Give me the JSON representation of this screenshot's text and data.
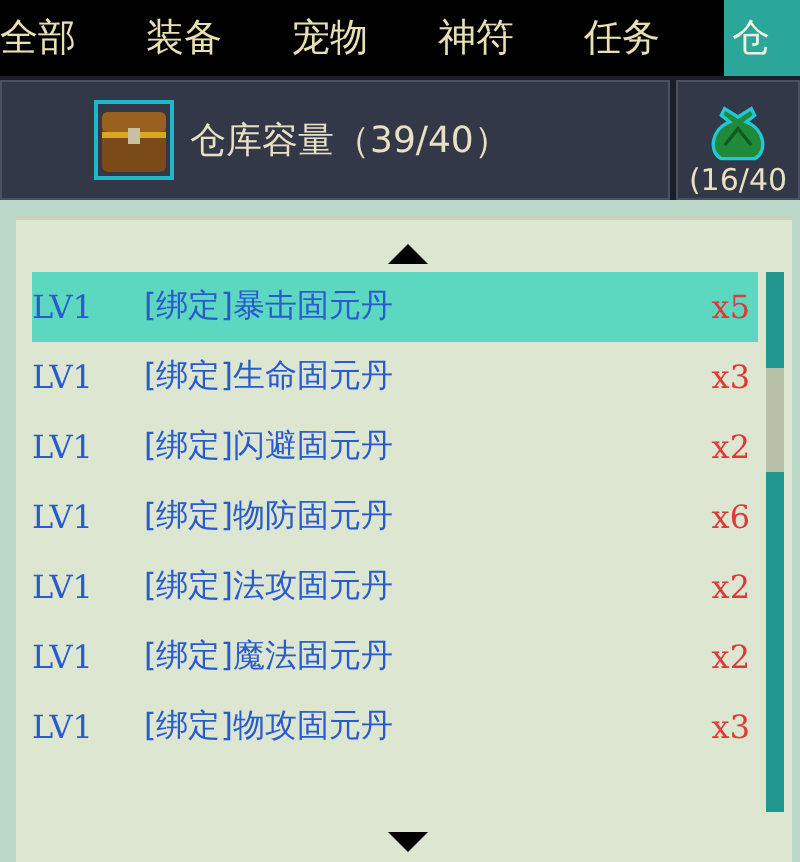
{
  "tabs": [
    {
      "label": "全部",
      "selected": false
    },
    {
      "label": "装备",
      "selected": false
    },
    {
      "label": "宠物",
      "selected": false
    },
    {
      "label": "神符",
      "selected": false
    },
    {
      "label": "任务",
      "selected": false
    },
    {
      "label": "仓",
      "selected": true
    }
  ],
  "capacity": {
    "label": "仓库容量（39/40）"
  },
  "bag": {
    "count": "(16/40"
  },
  "items": [
    {
      "level": "LV1",
      "name": "[绑定]暴击固元丹",
      "count": "x5",
      "selected": true
    },
    {
      "level": "LV1",
      "name": "[绑定]生命固元丹",
      "count": "x3",
      "selected": false
    },
    {
      "level": "LV1",
      "name": "[绑定]闪避固元丹",
      "count": "x2",
      "selected": false
    },
    {
      "level": "LV1",
      "name": "[绑定]物防固元丹",
      "count": "x6",
      "selected": false
    },
    {
      "level": "LV1",
      "name": "[绑定]法攻固元丹",
      "count": "x2",
      "selected": false
    },
    {
      "level": "LV1",
      "name": "[绑定]魔法固元丹",
      "count": "x2",
      "selected": false
    },
    {
      "level": "LV1",
      "name": "[绑定]物攻固元丹",
      "count": "x3",
      "selected": false
    }
  ]
}
